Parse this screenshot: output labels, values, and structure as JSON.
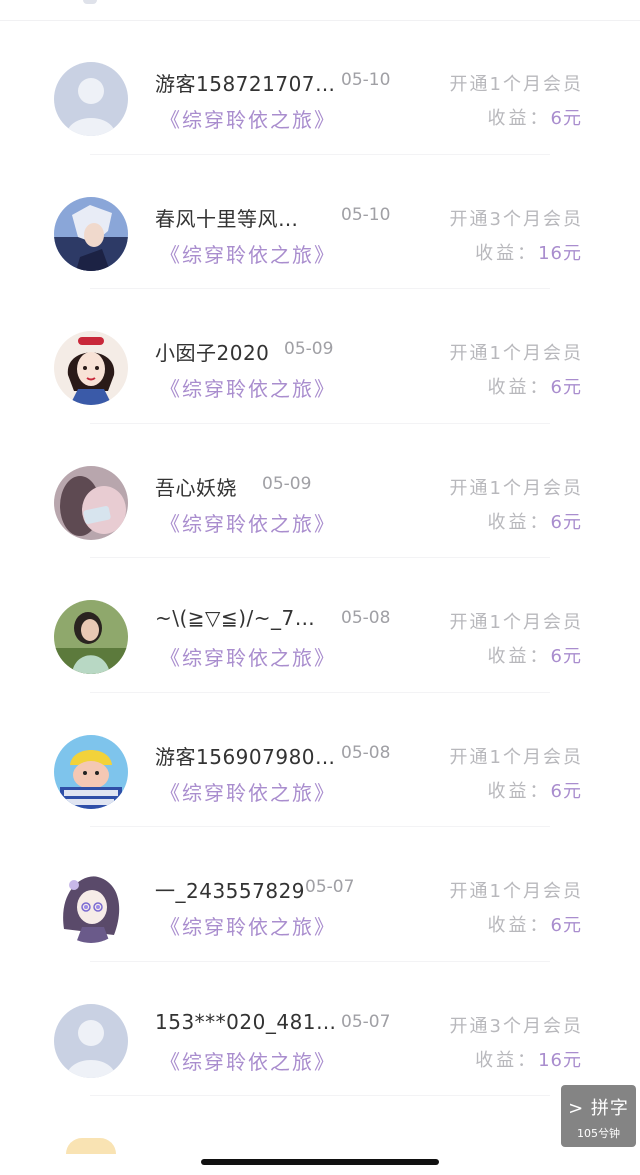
{
  "records": [
    {
      "name": "游客158721707…",
      "date": "05-10",
      "book": "《综穿聆依之旅》",
      "plan": "开通1个月会员",
      "income_label": "收益：",
      "income_amount": "6元",
      "avatar": "default-avatar"
    },
    {
      "name": "春风十里等风…",
      "date": "05-10",
      "book": "《综穿聆依之旅》",
      "plan": "开通3个月会员",
      "income_label": "收益：",
      "income_amount": "16元",
      "avatar": "anime-boy-avatar"
    },
    {
      "name": "小囡子2020",
      "date": "05-09",
      "book": "《综穿聆依之旅》",
      "plan": "开通1个月会员",
      "income_label": "收益：",
      "income_amount": "6元",
      "avatar": "snow-white-avatar"
    },
    {
      "name": "吾心妖娆",
      "date": "05-09",
      "book": "《综穿聆依之旅》",
      "plan": "开通1个月会员",
      "income_label": "收益：",
      "income_amount": "6元",
      "avatar": "photo-avatar"
    },
    {
      "name": "~\\(≧▽≦)/~_7…",
      "date": "05-08",
      "book": "《综穿聆依之旅》",
      "plan": "开通1个月会员",
      "income_label": "收益：",
      "income_amount": "6元",
      "avatar": "woman-photo-avatar"
    },
    {
      "name": "游客156907980…",
      "date": "05-08",
      "book": "《综穿聆依之旅》",
      "plan": "开通1个月会员",
      "income_label": "收益：",
      "income_amount": "6元",
      "avatar": "cartoon-meme-avatar"
    },
    {
      "name": "一_243557829",
      "date": "05-07",
      "book": "《综穿聆依之旅》",
      "plan": "开通1个月会员",
      "income_label": "收益：",
      "income_amount": "6元",
      "avatar": "anime-girl-avatar"
    },
    {
      "name": "153***020_481…",
      "date": "05-07",
      "book": "《综穿聆依之旅》",
      "plan": "开通3个月会员",
      "income_label": "收益：",
      "income_amount": "16元",
      "avatar": "default-avatar"
    }
  ],
  "pinyin_badge": {
    "title": "> 拼字",
    "subtitle": "105兮钟"
  },
  "colors": {
    "accent": "#a98dce",
    "muted": "#b8b8bc",
    "name": "#333333"
  }
}
